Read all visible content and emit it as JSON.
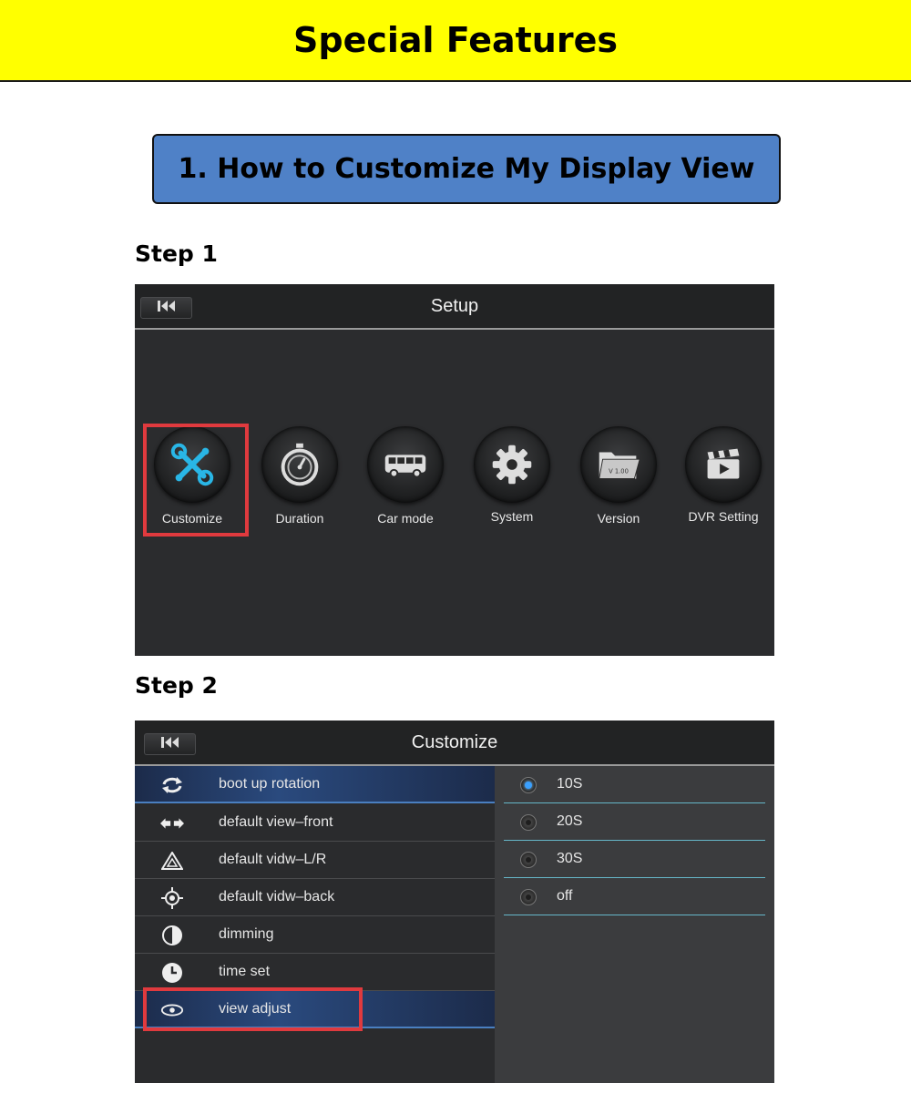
{
  "banner": {
    "title": "Special Features"
  },
  "section": {
    "title": "1. How to Customize My Display View"
  },
  "steps": {
    "step1": "Step 1",
    "step2": "Step 2"
  },
  "colors": {
    "banner_bg": "#ffff00",
    "section_bg": "#4f81c7",
    "highlight": "#e03a3e",
    "screen_bg": "#2b2c2e",
    "accent_blue": "#3aa0ff"
  },
  "setup_screen": {
    "title": "Setup",
    "back_icon": "skip-back-icon",
    "items": [
      {
        "label": "Customize",
        "icon": "tools-icon",
        "highlighted": true
      },
      {
        "label": "Duration",
        "icon": "stopwatch-icon"
      },
      {
        "label": "Car mode",
        "icon": "bus-icon"
      },
      {
        "label": "System",
        "icon": "gear-icon"
      },
      {
        "label": "Version",
        "icon": "folder-version-icon",
        "badge": "V 1.00"
      },
      {
        "label": "DVR Setting",
        "icon": "clapperboard-icon"
      }
    ]
  },
  "customize_screen": {
    "title": "Customize",
    "back_icon": "skip-back-icon",
    "list": [
      {
        "label": "boot up rotation",
        "icon": "rotate-icon",
        "active": true
      },
      {
        "label": "default view–front",
        "icon": "left-right-arrows-icon"
      },
      {
        "label": "default vidw–L/R",
        "icon": "warning-triangle-icon"
      },
      {
        "label": "default vidw–back",
        "icon": "crosshair-icon"
      },
      {
        "label": "dimming",
        "icon": "half-circle-icon"
      },
      {
        "label": "time set",
        "icon": "clock-icon"
      },
      {
        "label": "view adjust",
        "icon": "eye-icon",
        "active": true,
        "highlighted": true
      }
    ],
    "options": [
      {
        "label": "10S",
        "selected": true
      },
      {
        "label": "20S",
        "selected": false
      },
      {
        "label": "30S",
        "selected": false
      },
      {
        "label": "off",
        "selected": false
      }
    ]
  }
}
